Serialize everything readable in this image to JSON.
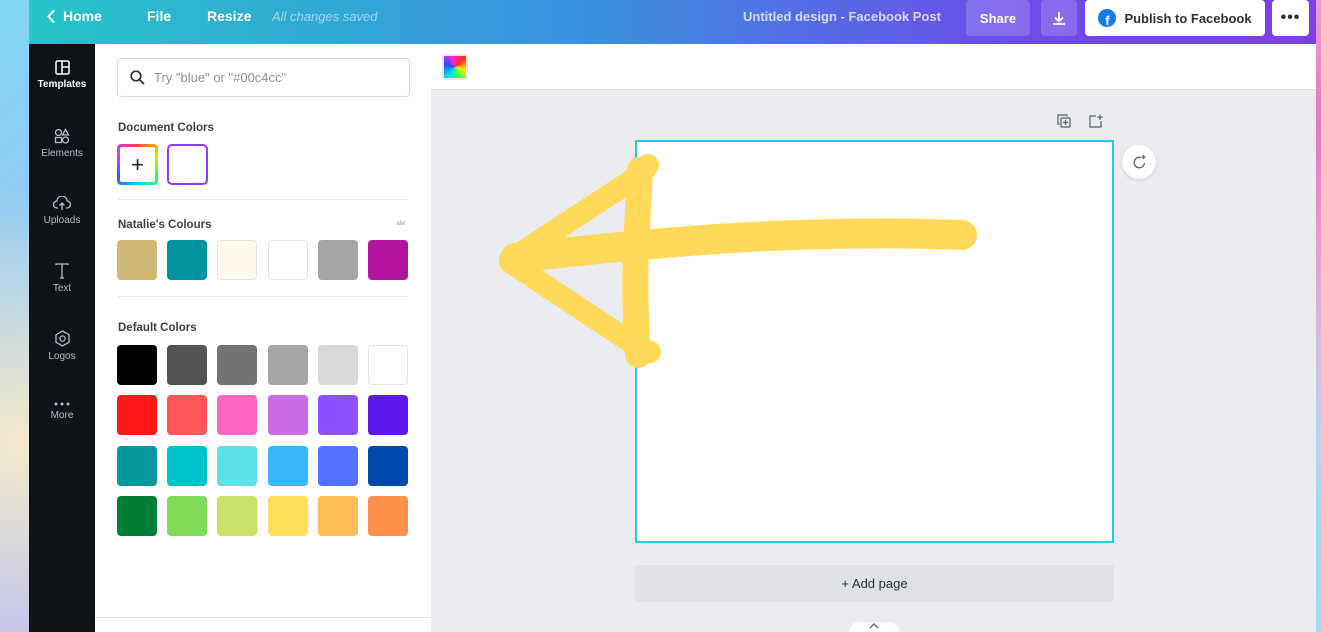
{
  "topbar": {
    "home_label": "Home",
    "file_label": "File",
    "resize_label": "Resize",
    "saved_status": "All changes saved",
    "design_title": "Untitled design - Facebook Post",
    "share_label": "Share",
    "publish_label": "Publish to Facebook",
    "more_label": "•••"
  },
  "leftnav": {
    "items": [
      {
        "label": "Templates",
        "icon": "templates-icon"
      },
      {
        "label": "Elements",
        "icon": "elements-icon"
      },
      {
        "label": "Uploads",
        "icon": "uploads-icon"
      },
      {
        "label": "Text",
        "icon": "text-icon"
      },
      {
        "label": "Logos",
        "icon": "logos-icon"
      },
      {
        "label": "More",
        "icon": "more-icon"
      }
    ]
  },
  "panel": {
    "search_placeholder": "Try \"blue\" or \"#00c4cc\"",
    "document_colors_title": "Document Colors",
    "add_color_symbol": "+",
    "document_colors": [
      "#ffffff"
    ],
    "brand_colors_title": "Natalie's Colours",
    "brand_colors": [
      "#d1b876",
      "#00949e",
      "#fff7eb",
      "#ffffff",
      "#a5a5a5",
      "#b3169f"
    ],
    "default_colors_title": "Default Colors",
    "default_colors": [
      [
        "#000000",
        "#545454",
        "#737373",
        "#a6a6a6",
        "#d9d9d9",
        "#ffffff"
      ],
      [
        "#ff1616",
        "#ff5757",
        "#ff66c4",
        "#cb6ce6",
        "#8c52ff",
        "#5e17eb"
      ],
      [
        "#03989e",
        "#00c2cb",
        "#5ce1e6",
        "#38b6ff",
        "#5271ff",
        "#004aad"
      ],
      [
        "#008037",
        "#7ed957",
        "#c9e265",
        "#ffde59",
        "#ffbd59",
        "#ff914d"
      ]
    ]
  },
  "editor": {
    "add_page_label": "+ Add page"
  },
  "overlay": {
    "arrow_color": "#ffd95a"
  }
}
